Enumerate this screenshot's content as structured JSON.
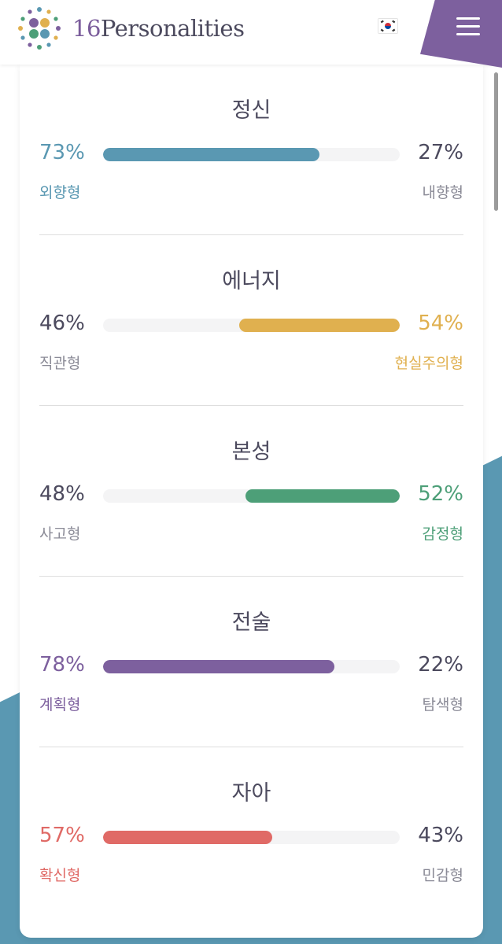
{
  "header": {
    "logo_number": "16",
    "logo_word": "Personalities",
    "language_flag": "south-korea-flag-icon",
    "menu_icon": "hamburger-menu-icon"
  },
  "colors": {
    "blue": "#5a98b2",
    "yellow": "#e0b04f",
    "green": "#4d9f78",
    "purple": "#7d609e",
    "red": "#e06a66",
    "neutral_text": "#4c4a5e",
    "neutral_label": "#8b8b97",
    "track": "#f4f4f5"
  },
  "traits": [
    {
      "title": "정신",
      "left_pct": "73%",
      "right_pct": "27%",
      "left_label": "외향형",
      "right_label": "내향형",
      "dominant": "left",
      "value": 73,
      "color": "#5a98b2"
    },
    {
      "title": "에너지",
      "left_pct": "46%",
      "right_pct": "54%",
      "left_label": "직관형",
      "right_label": "현실주의형",
      "dominant": "right",
      "value": 54,
      "color": "#e0b04f"
    },
    {
      "title": "본성",
      "left_pct": "48%",
      "right_pct": "52%",
      "left_label": "사고형",
      "right_label": "감정형",
      "dominant": "right",
      "value": 52,
      "color": "#4d9f78"
    },
    {
      "title": "전술",
      "left_pct": "78%",
      "right_pct": "22%",
      "left_label": "계획형",
      "right_label": "탐색형",
      "dominant": "left",
      "value": 78,
      "color": "#7d609e"
    },
    {
      "title": "자아",
      "left_pct": "57%",
      "right_pct": "43%",
      "left_label": "확신형",
      "right_label": "민감형",
      "dominant": "left",
      "value": 57,
      "color": "#e06a66"
    }
  ]
}
